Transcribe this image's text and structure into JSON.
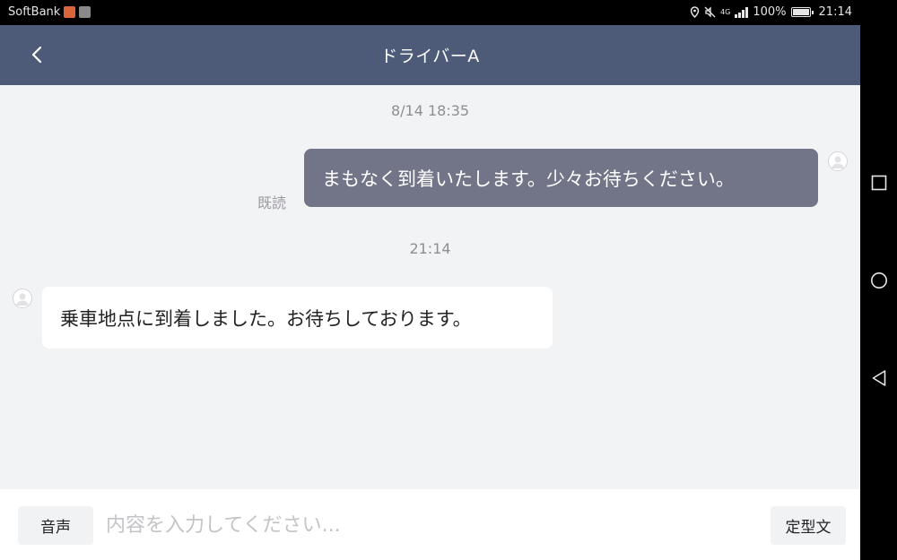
{
  "status_bar": {
    "carrier": "SoftBank",
    "signal": "4G",
    "battery": "100%",
    "time": "21:14"
  },
  "header": {
    "title": "ドライバーA",
    "back_icon": "chevron-left-icon"
  },
  "messages": [
    {
      "time": "8/14 18:35",
      "direction": "outgoing",
      "text": "まもなく到着いたします。少々お待ちください。",
      "read_label": "既読"
    },
    {
      "time": "21:14",
      "direction": "incoming",
      "text": "乗車地点に到着しました。お待ちしております。"
    }
  ],
  "input_bar": {
    "voice_label": "音声",
    "placeholder": "内容を入力してください...",
    "template_label": "定型文"
  },
  "nav_bar": {
    "icons": [
      "recent-apps-icon",
      "home-icon",
      "back-icon"
    ]
  },
  "colors": {
    "header_bg": "#4d5a78",
    "outgoing_bubble": "#727587",
    "incoming_bubble": "#ffffff",
    "background": "#f2f3f5"
  }
}
